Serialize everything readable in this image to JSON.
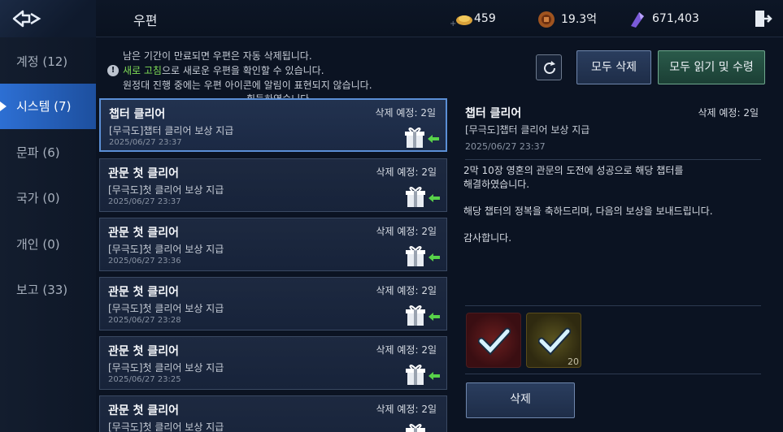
{
  "header": {
    "title": "우편",
    "currencies": [
      {
        "icon": "gold-ingot-icon",
        "value": "459"
      },
      {
        "icon": "copper-coin-icon",
        "value": "19.3억"
      },
      {
        "icon": "purple-crystal-icon",
        "value": "671,403"
      }
    ]
  },
  "sidebar": {
    "items": [
      {
        "label": "계정 (12)",
        "active": false
      },
      {
        "label": "시스템 (7)",
        "active": true
      },
      {
        "label": "문파 (6)",
        "active": false
      },
      {
        "label": "국가 (0)",
        "active": false
      },
      {
        "label": "개인 (0)",
        "active": false
      },
      {
        "label": "보고 (33)",
        "active": false
      }
    ]
  },
  "notice": {
    "line1": "남은 기간이 만료되면 우편은 자동 삭제됩니다.",
    "line2_highlight": "새로 고침",
    "line2_rest": "으로 새로운 우편을 확인할 수 있습니다.",
    "line3": "원정대 진행 중에는 우편 아이콘에 알림이 표현되지 않습니다.",
    "line4": "획득하였습니다."
  },
  "toolbar": {
    "delete_all_label": "모두 삭제",
    "read_all_label": "모두 읽기 및 수령"
  },
  "mails": [
    {
      "title": "챕터 클리어",
      "sub": "[무극도]챕터 클리어 보상 지급",
      "date": "2025/06/27 23:37",
      "expire": "삭제 예정: 2일"
    },
    {
      "title": "관문 첫 클리어",
      "sub": "[무극도]첫 클리어 보상 지급",
      "date": "2025/06/27 23:37",
      "expire": "삭제 예정: 2일"
    },
    {
      "title": "관문 첫 클리어",
      "sub": "[무극도]첫 클리어 보상 지급",
      "date": "2025/06/27 23:36",
      "expire": "삭제 예정: 2일"
    },
    {
      "title": "관문 첫 클리어",
      "sub": "[무극도]첫 클리어 보상 지급",
      "date": "2025/06/27 23:28",
      "expire": "삭제 예정: 2일"
    },
    {
      "title": "관문 첫 클리어",
      "sub": "[무극도]첫 클리어 보상 지급",
      "date": "2025/06/27 23:25",
      "expire": "삭제 예정: 2일"
    },
    {
      "title": "관문 첫 클리어",
      "sub": "[무극도]첫 클리어 보상 지급",
      "date": "",
      "expire": "삭제 예정: 2일"
    }
  ],
  "detail": {
    "title": "챕터 클리어",
    "expire": "삭제 예정: 2일",
    "sub": "[무극도]챕터 클리어 보상 지급",
    "date": "2025/06/27 23:37",
    "body1": "2막 10장 영혼의 관문의 도전에 성공으로 해당 챕터를",
    "body2": "해결하였습니다.",
    "body3": "해당 챕터의 정복을 축하드리며, 다음의 보상을 보내드립니다.",
    "body4": "감사합니다.",
    "rewards": [
      {
        "icon": "red-ore-reward-icon",
        "qty": ""
      },
      {
        "icon": "jade-stone-reward-icon",
        "qty": "20"
      }
    ],
    "delete_label": "삭제"
  }
}
